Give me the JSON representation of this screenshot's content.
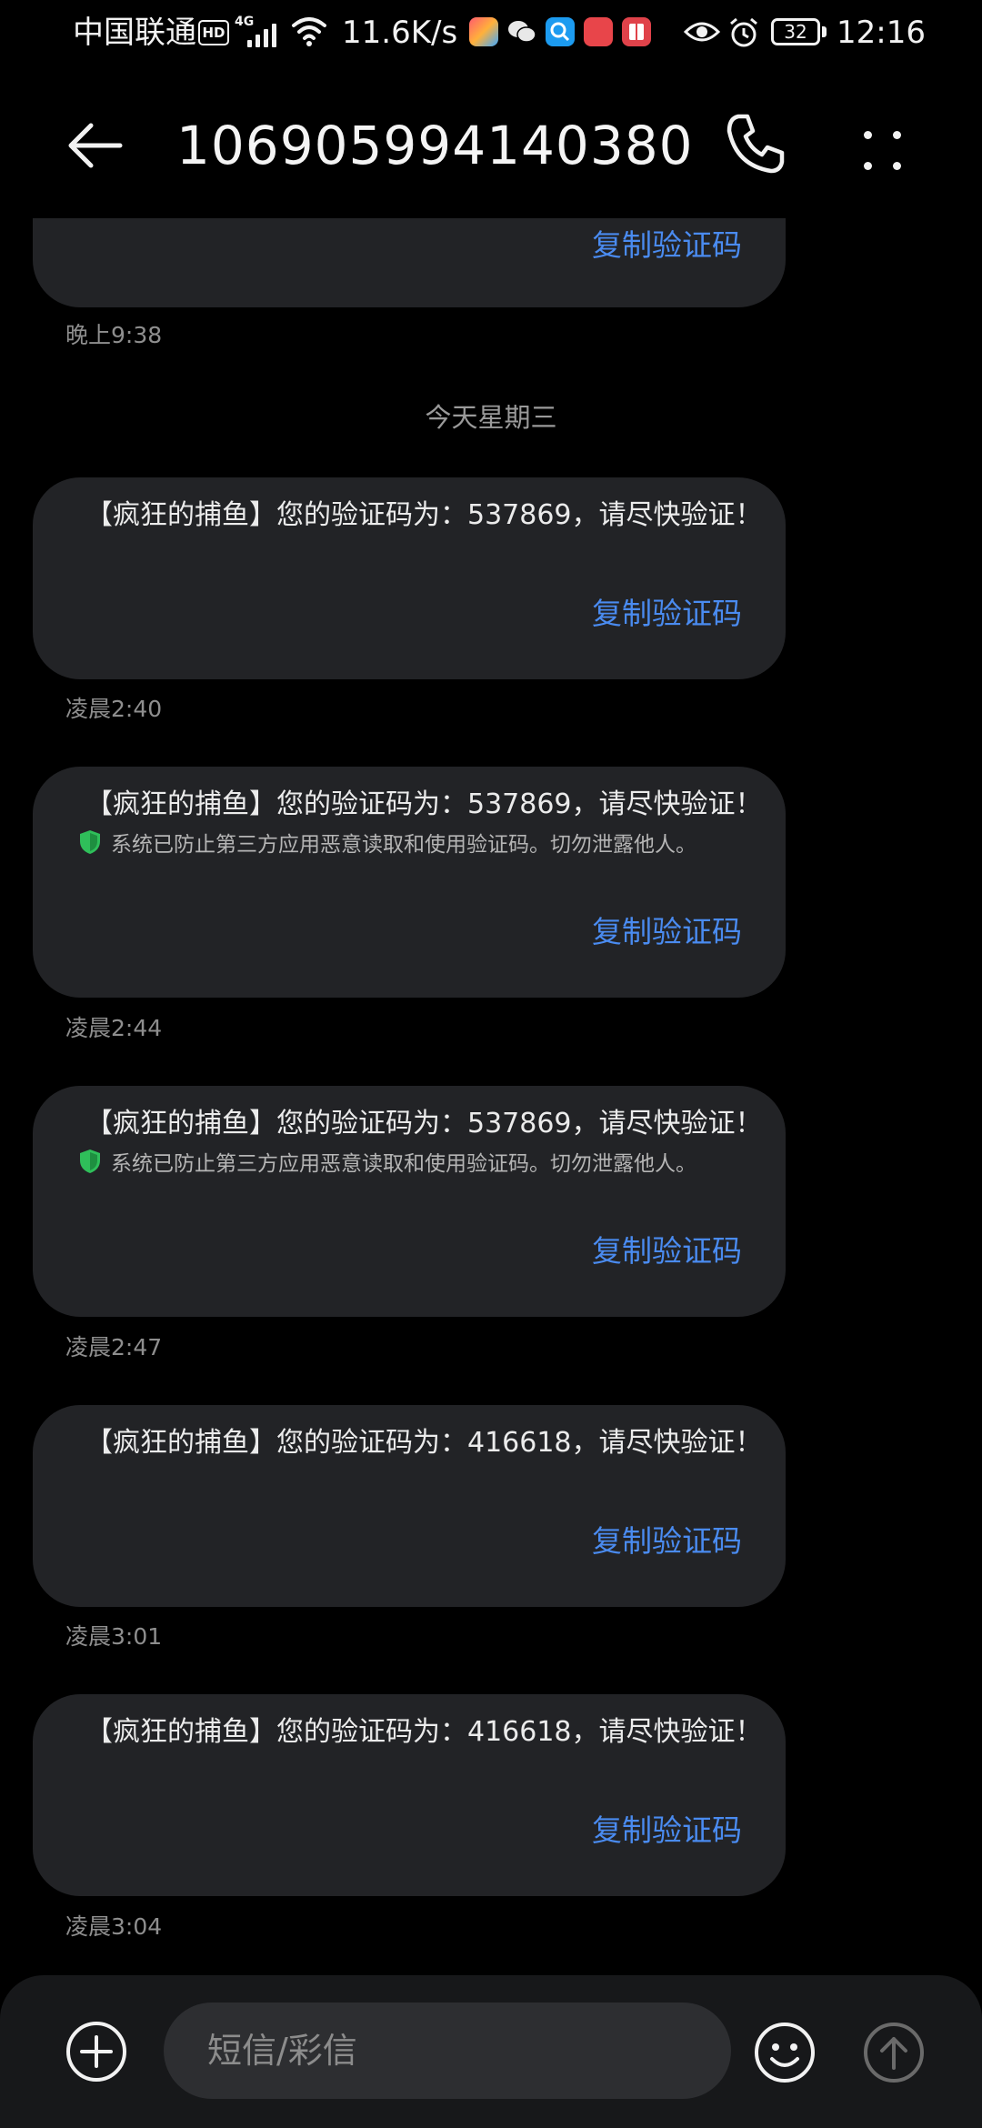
{
  "status_bar": {
    "carrier": "中国联通",
    "hd_badge": "HD",
    "network_type": "4G",
    "net_speed": "11.6K/s",
    "battery": "32",
    "time": "12:16",
    "app_icons": [
      "store-icon",
      "wechat-icon",
      "browser-icon",
      "huawei-shop-icon",
      "book-icon"
    ]
  },
  "header": {
    "title": "106905994140380",
    "icons": {
      "back": "back-arrow-icon",
      "call": "phone-icon",
      "more": "more-vertical-icon"
    }
  },
  "messages": {
    "m0": {
      "copy_label": "复制验证码",
      "time": "晚上9:38"
    },
    "date_separator": "今天星期三",
    "m1": {
      "text": "【疯狂的捕鱼】您的验证码为：537869，请尽快验证！",
      "copy_label": "复制验证码",
      "time": "凌晨2:40"
    },
    "m2": {
      "text": "【疯狂的捕鱼】您的验证码为：537869，请尽快验证！",
      "notice": "系统已防止第三方应用恶意读取和使用验证码。切勿泄露他人。",
      "copy_label": "复制验证码",
      "time": "凌晨2:44"
    },
    "m3": {
      "text": "【疯狂的捕鱼】您的验证码为：537869，请尽快验证！",
      "notice": "系统已防止第三方应用恶意读取和使用验证码。切勿泄露他人。",
      "copy_label": "复制验证码",
      "time": "凌晨2:47"
    },
    "m4": {
      "text": "【疯狂的捕鱼】您的验证码为：416618，请尽快验证！",
      "copy_label": "复制验证码",
      "time": "凌晨3:01"
    },
    "m5": {
      "text": "【疯狂的捕鱼】您的验证码为：416618，请尽快验证！",
      "copy_label": "复制验证码",
      "time": "凌晨3:04"
    }
  },
  "composer": {
    "placeholder": "短信/彩信",
    "icons": {
      "add": "add-circle-icon",
      "emoji": "emoji-icon",
      "send": "send-icon"
    }
  },
  "colors": {
    "background": "#000000",
    "bubble": "#222326",
    "accent_link": "#4a8bf0",
    "shield_green": "#2fbf5a",
    "timestamp": "#8e8e8e"
  }
}
